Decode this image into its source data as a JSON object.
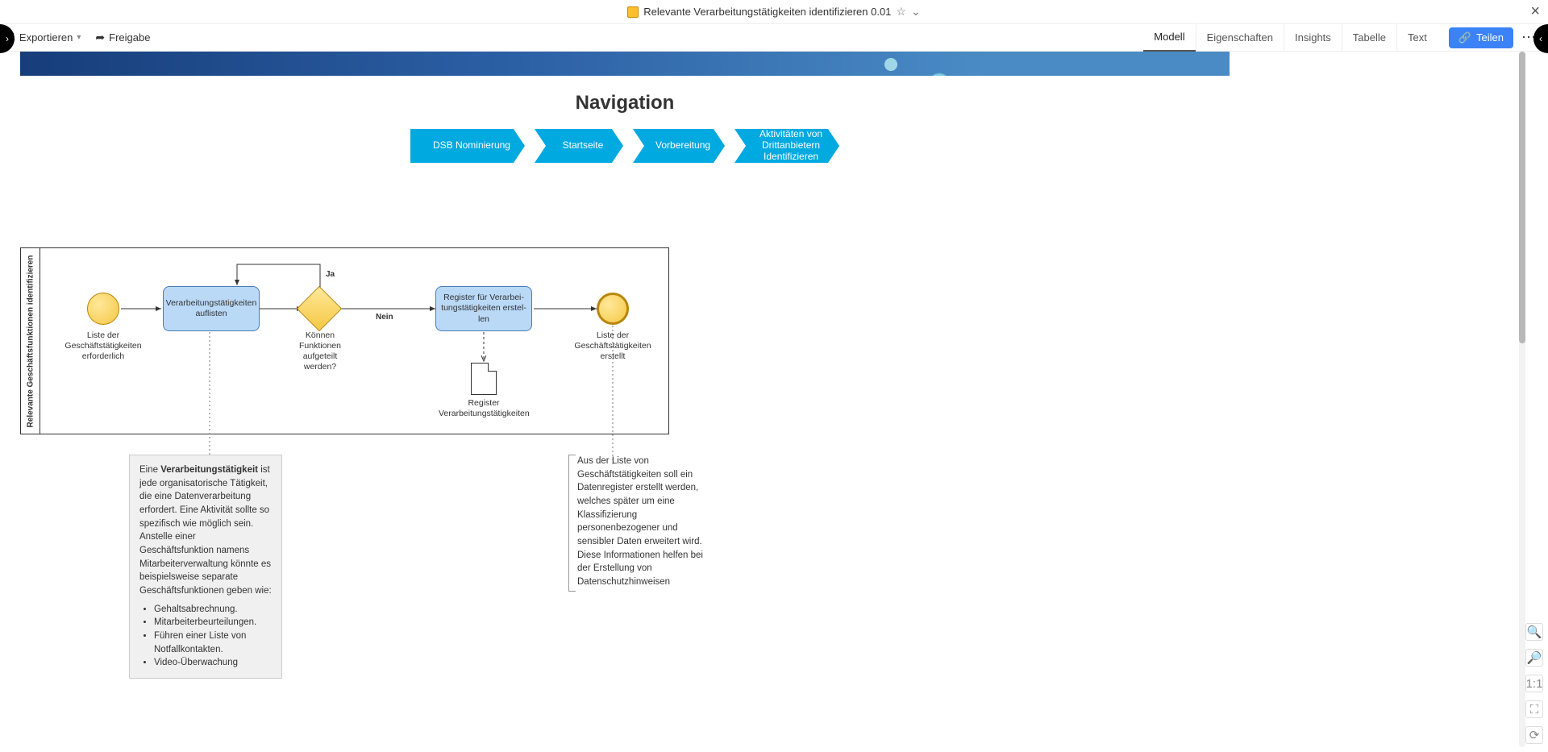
{
  "titlebar": {
    "title": "Relevante Verarbeitungstätigkeiten identifizieren 0.01"
  },
  "toolbar": {
    "export": "Exportieren",
    "release": "Freigabe",
    "tabs": [
      "Modell",
      "Eigenschaften",
      "Insights",
      "Tabelle",
      "Text"
    ],
    "active_tab": 0,
    "share": "Teilen"
  },
  "navigation": {
    "title": "Navigation",
    "buttons": [
      "DSB Nominierung",
      "Startseite",
      "Vorbereitung",
      "Aktivitäten von Dritt­anbietern Identifizie­ren"
    ]
  },
  "pool_name": "Relevante Geschäftsfunktionen identifizieren",
  "elements": {
    "start_label": "Liste der Geschäftstätigkeiten erforderlich",
    "task1": "Verarbeitungstätigkeiten auflisten",
    "gateway": "Können Funktionen aufgeteilt werden?",
    "gw_yes": "Ja",
    "gw_no": "Nein",
    "task2": "Register für Verarbei­tungstätigkeiten erstel­len",
    "doc": "Register Verarbeitungstätigkeiten",
    "end_label": "Liste der Geschäftstätigkeiten erstellt"
  },
  "annotation1": {
    "text_before": "Eine ",
    "bold": "Verarbeitungstätigkeit",
    "text_after": " ist jede organisatorische Tätigkeit, die eine Datenverarbeitung erfordert. Eine Aktivität sollte so spezifisch wie möglich sein. Anstelle einer Geschäftsfunktion namens Mitarbeiterverwaltung könnte es beispielsweise separate Geschäftsfunktionen geben wie:",
    "bullets": [
      "Gehaltsabrechnung.",
      "Mitarbeiterbeurteilungen.",
      "Führen einer Liste von Notfallkontakten.",
      "Video-Überwachung"
    ]
  },
  "annotation2": "Aus der Liste von Geschäftstätigkeiten soll ein Datenregister erstellt werden, welches später um eine Klassifizierung personenbezogener und sensibler Daten erweitert wird. Diese Informationen helfen bei der Erstellung von Datenschutzhinweisen"
}
